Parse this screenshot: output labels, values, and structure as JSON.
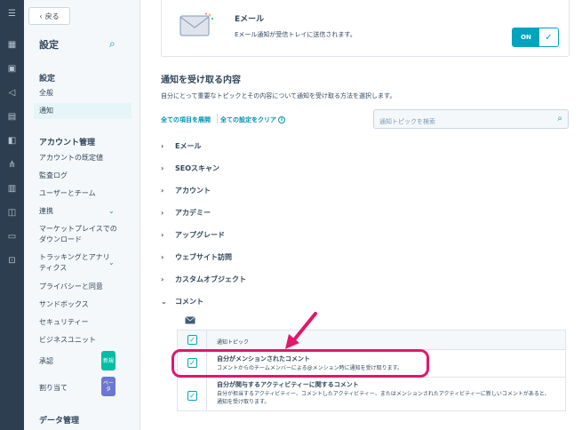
{
  "sidebar": {
    "back_label": "戻る",
    "title": "設定",
    "sections": [
      {
        "label": "設定",
        "items": [
          "全般",
          "通知"
        ]
      },
      {
        "label": "アカウント管理",
        "items": [
          "アカウントの既定値",
          "監査ログ",
          "ユーザーとチーム",
          "連携",
          "マーケットプレイスでのダウンロード",
          "トラッキングとアナリティクス",
          "プライバシーと同意",
          "サンドボックス",
          "セキュリティー",
          "ビジネスユニット",
          "承認",
          "割り当て"
        ]
      },
      {
        "label": "データ管理"
      }
    ],
    "badges": {
      "new": "新規",
      "beta": "ベータ"
    }
  },
  "email_card": {
    "title": "Eメール",
    "description": "Eメール通知が受信トレイに送信されます。",
    "toggle_label": "ON"
  },
  "topics": {
    "title": "通知を受け取る内容",
    "description": "自分にとって重要なトピックとその内容について通知を受け取る方法を選択します。",
    "expand_all": "全ての項目を展開",
    "clear_all": "全ての設定をクリア",
    "search_placeholder": "通知トピックを検索",
    "categories": [
      "Eメール",
      "SEOスキャン",
      "アカウント",
      "アカデミー",
      "アップグレード",
      "ウェブサイト訪問",
      "カスタムオブジェクト",
      "コメント"
    ]
  },
  "comments_table": {
    "header": "通知トピック",
    "rows": [
      {
        "title": "自分がメンションされたコメント",
        "desc": "コメントからのチームメンバーによる@メンション時に通知を受け取ります。"
      },
      {
        "title": "自分が関与するアクティビティーに関するコメント",
        "desc": "自分が担当するアクティビティー、コメントしたアクティビティー、またはメンションされたアクティビティーに新しいコメントがあると、通知を受け取ります。"
      }
    ]
  },
  "colors": {
    "accent": "#00a4bd",
    "highlight": "#e0176c",
    "rail": "#2d3e50"
  }
}
